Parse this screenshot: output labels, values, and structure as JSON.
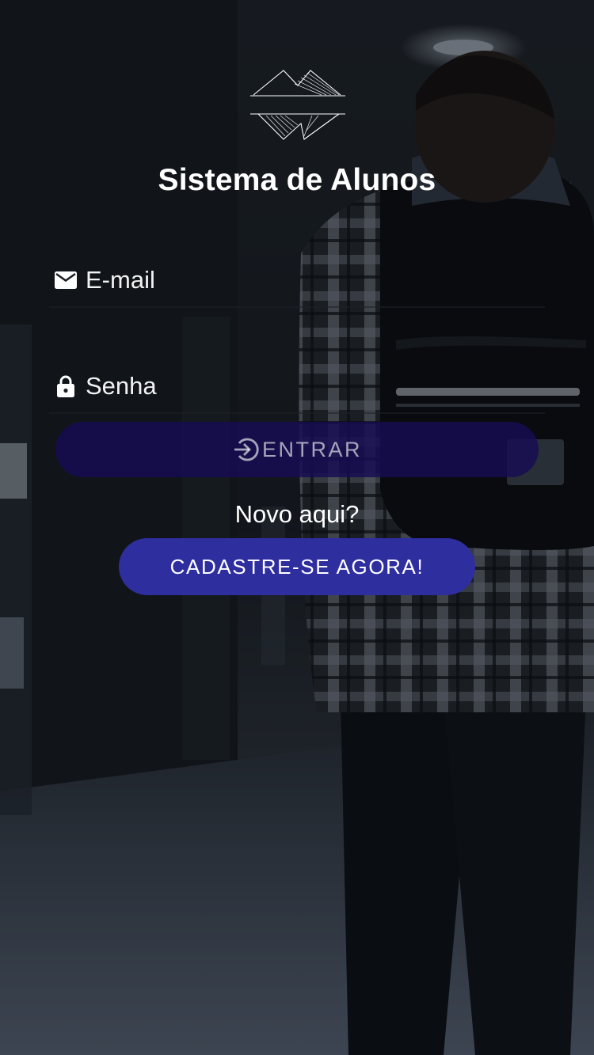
{
  "app": {
    "title": "Sistema de Alunos"
  },
  "login_form": {
    "email": {
      "placeholder": "E-mail",
      "value": "",
      "icon": "mail-icon"
    },
    "password": {
      "placeholder": "Senha",
      "value": "",
      "icon": "lock-icon"
    },
    "enter_button": {
      "label": "ENTRAR",
      "icon": "login-arrow-icon"
    }
  },
  "signup": {
    "prompt": "Novo aqui?",
    "button_label": "CADASTRE-SE AGORA!"
  },
  "colors": {
    "enter_button_bg": "#160c54",
    "signup_button_bg": "#2f2e9f",
    "text": "#ffffff"
  }
}
